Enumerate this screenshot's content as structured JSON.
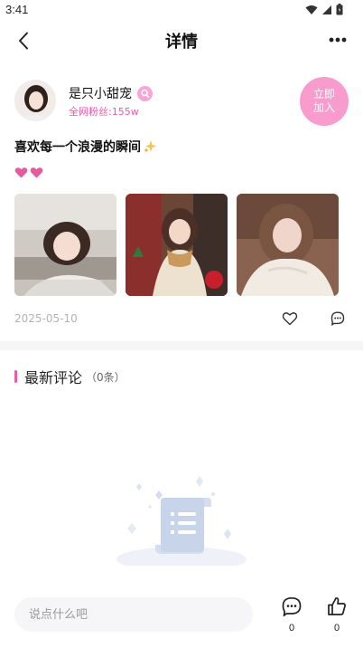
{
  "status_bar": {
    "time": "3:41"
  },
  "nav": {
    "title": "详情"
  },
  "profile": {
    "username": "是只小甜宠",
    "fans": "全网粉丝:155w",
    "join_label_line1": "立即",
    "join_label_line2": "加入"
  },
  "post": {
    "title": "喜欢每一个浪漫的瞬间",
    "date": "2025-05-10"
  },
  "comments": {
    "title": "最新评论",
    "count": "（0条）"
  },
  "bottom_bar": {
    "input_placeholder": "说点什么吧",
    "comment_count": "0",
    "like_count": "0"
  },
  "colors": {
    "accent_pink": "#ec5aa6",
    "join_button": "#f79ccd",
    "divider": "#f5f5f5"
  }
}
